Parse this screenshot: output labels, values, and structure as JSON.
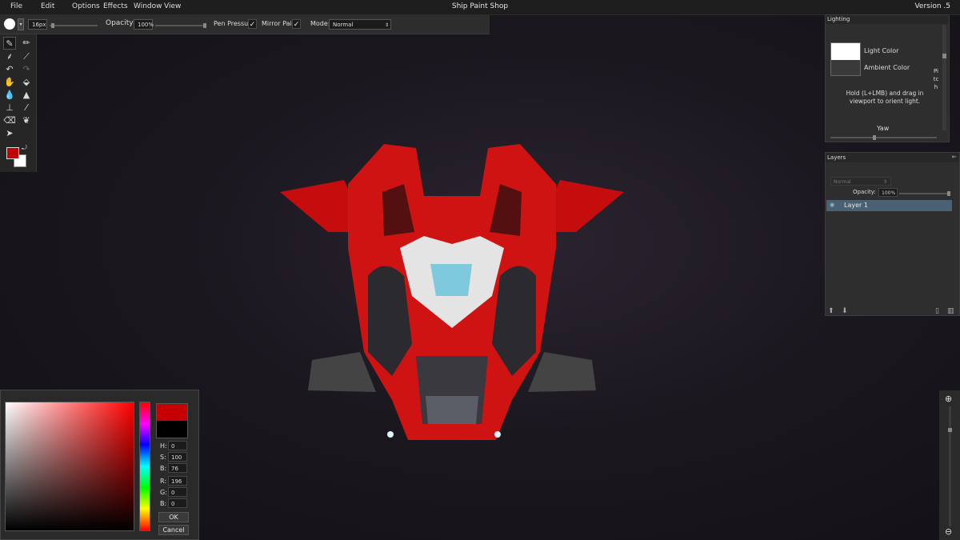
{
  "app": {
    "title": "Ship Paint Shop",
    "version": "Version .5"
  },
  "menu": {
    "file": "File",
    "edit": "Edit",
    "options": "Options",
    "effects": "Effects",
    "window": "Window",
    "view": "View"
  },
  "options_bar": {
    "brush_size": "16px",
    "opacity_label": "Opacity:",
    "opacity_value": "100%",
    "pen_pressure_label": "Pen Pressure",
    "pen_pressure_check": "✓",
    "mirror_paint_label": "Mirror Paint",
    "mirror_paint_check": "✓",
    "mode_label": "Mode:",
    "mode_value": "Normal"
  },
  "colors": {
    "foreground": "#c40000",
    "background": "#ffffff",
    "accent": "#4a6173"
  },
  "color_picker": {
    "h_label": "H:",
    "h": "0",
    "s_label": "S:",
    "s": "100",
    "b_label": "B:",
    "b": "76",
    "r_label": "R:",
    "r": "196",
    "g_label": "G:",
    "g": "0",
    "bl_label": "B:",
    "bl": "0",
    "ok": "OK",
    "cancel": "Cancel"
  },
  "lighting": {
    "title": "Lighting",
    "light_color": "Light Color",
    "ambient_color": "Ambient Color",
    "hint": "Hold (L+LMB) and drag in viewport to orient light.",
    "pitch": "Pitch",
    "yaw": "Yaw"
  },
  "layers": {
    "title": "Layers",
    "blend_mode": "Normal",
    "opacity_label": "Opacity:",
    "opacity_value": "100%",
    "items": [
      {
        "name": "Layer 1"
      }
    ]
  },
  "tools": [
    "brush-icon",
    "pencil-icon",
    "smudge-icon",
    "line-icon",
    "undo-icon",
    "redo-icon",
    "hand-icon",
    "fill-icon",
    "blur-icon",
    "sharpen-icon",
    "stamp-icon",
    "eyedropper-icon",
    "eraser-icon",
    "wing-icon",
    "pointer-icon"
  ]
}
